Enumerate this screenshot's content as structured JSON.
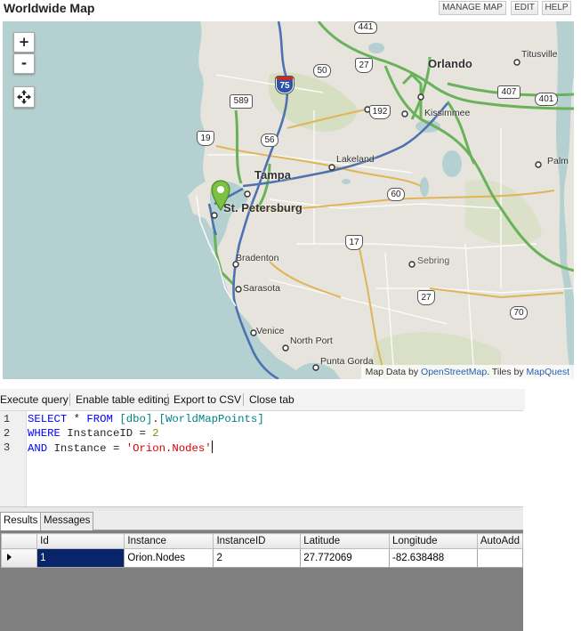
{
  "header": {
    "title": "Worldwide Map",
    "buttons": {
      "manage_map": "MANAGE MAP",
      "edit": "EDIT",
      "help": "HELP"
    }
  },
  "map": {
    "zoom_in": "+",
    "zoom_out": "-",
    "pan_icon": "move-arrows-icon",
    "marker_icon": "map-pin-icon",
    "marker_color": "#7cc242",
    "colors": {
      "water": "#b5d0d0",
      "land": "#e6e4dc",
      "motorway": "#4e72b0",
      "trunk": "#6ab25a"
    },
    "places": {
      "orlando": "Orlando",
      "titusville": "Titusville",
      "kissimmee": "Kissimmee",
      "lakeland": "Lakeland",
      "tampa": "Tampa",
      "st_petersburg": "St. Petersburg",
      "palm": "Palm",
      "bradenton": "Bradenton",
      "sebring": "Sebring",
      "sarasota": "Sarasota",
      "venice": "Venice",
      "north_port": "North Port",
      "punta_gorda": "Punta Gorda"
    },
    "shields": {
      "s441": "441",
      "s27a": "27",
      "s50": "50",
      "s75": "75",
      "s589": "589",
      "s192": "192",
      "s407": "407",
      "s401": "401",
      "s19": "19",
      "s56": "56",
      "s60": "60",
      "s17": "17",
      "s27b": "27",
      "s70": "70"
    },
    "attribution": {
      "prefix": "Map Data by ",
      "osm": "OpenStreetMap",
      "middle": ". Tiles by ",
      "mapquest": "MapQuest"
    }
  },
  "toolbar": {
    "execute": "Execute query",
    "enable_editing": "Enable table editing",
    "export_csv": "Export to CSV",
    "close_tab": "Close tab"
  },
  "editor": {
    "line_numbers": [
      "1",
      "2",
      "3"
    ],
    "line1": {
      "select": "SELECT",
      "star": " * ",
      "from": "FROM",
      "obj1": " [dbo]",
      "dot": ".",
      "obj2": "[WorldMapPoints]"
    },
    "line2": {
      "where": "WHERE",
      "col": " InstanceID ",
      "eq": "=",
      "val": " 2"
    },
    "line3": {
      "and": "AND",
      "col": " Instance ",
      "eq": "=",
      "val": " 'Orion.Nodes'"
    }
  },
  "results": {
    "tabs": [
      "Results",
      "Messages"
    ],
    "columns": [
      "Id",
      "Instance",
      "InstanceID",
      "Latitude",
      "Longitude",
      "AutoAdd"
    ],
    "rows": [
      {
        "id": "1",
        "instance": "Orion.Nodes",
        "instance_id": "2",
        "latitude": "27.772069",
        "longitude": "-82.638488",
        "auto_add": ""
      }
    ]
  }
}
